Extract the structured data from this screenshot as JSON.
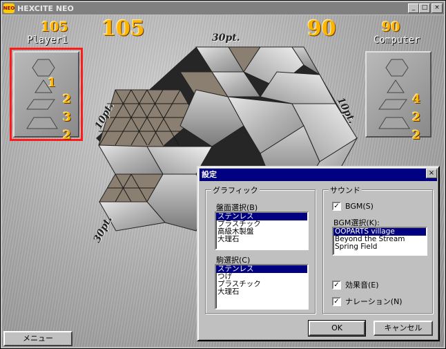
{
  "window": {
    "title": "HEXCITE NEO",
    "app_icon": "NEO",
    "minimize": "_",
    "maximize": "□",
    "close": "×"
  },
  "scoreboard": {
    "player": {
      "name": "Player1",
      "score_small": "105",
      "score_big": "105",
      "pieces": [
        "1",
        "2",
        "3",
        "2"
      ]
    },
    "computer": {
      "name": "Computer",
      "score_small": "90",
      "score_big": "90",
      "pieces": [
        "4",
        "2",
        "2"
      ]
    }
  },
  "board": {
    "point_labels": {
      "top": "30pt.",
      "right": "10pt.",
      "left": "10pt.",
      "bottom_left": "30pt."
    },
    "colors": {
      "steel_light": "#d6d6d6",
      "steel_mid": "#a8a8a8",
      "steel_dark": "#6e6e6e",
      "empty_cell": "#8a7f70",
      "grid_line": "#1a1a1a"
    }
  },
  "menu_button": "メニュー",
  "settings_dialog": {
    "title": "設定",
    "close": "×",
    "graphics": {
      "legend": "グラフィック",
      "board_label": "盤面選択(B)",
      "board_options": [
        "ステンレス",
        "プラスチック",
        "高級木製盤",
        "大理石"
      ],
      "board_selected": 0,
      "piece_label": "駒選択(C)",
      "piece_options": [
        "ステンレス",
        "つげ",
        "プラスチック",
        "大理石"
      ],
      "piece_selected": 0
    },
    "sound": {
      "legend": "サウンド",
      "bgm_checkbox": "BGM(S)",
      "bgm_checked": true,
      "bgm_select_label": "BGM選択(K):",
      "bgm_options": [
        "OOPARTS village",
        "Beyond the Stream",
        "Spring Field"
      ],
      "bgm_selected": 0,
      "sfx_checkbox": "効果音(E)",
      "sfx_checked": true,
      "narration_checkbox": "ナレーション(N)",
      "narration_checked": true
    },
    "ok": "OK",
    "cancel": "キャンセル"
  }
}
